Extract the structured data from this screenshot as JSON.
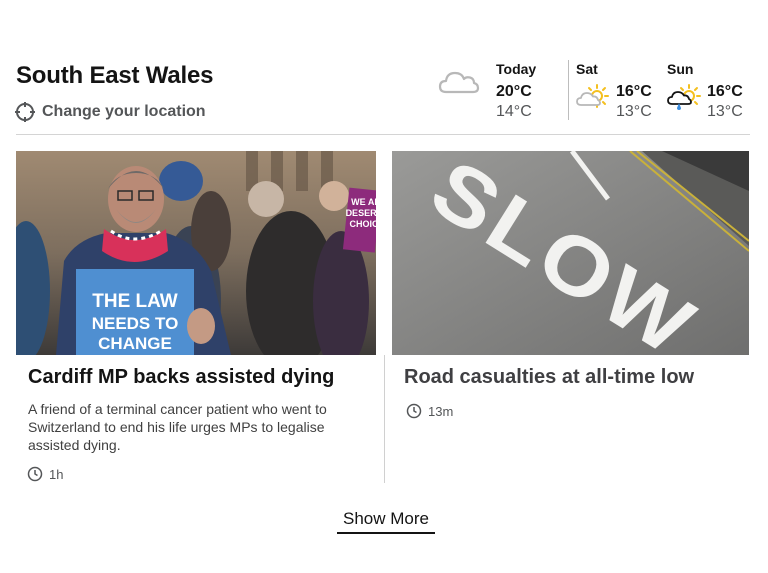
{
  "location": {
    "title": "South East Wales",
    "change_label": "Change your location"
  },
  "weather": {
    "today": {
      "day": "Today",
      "high": "20°C",
      "low": "14°C",
      "icon": "cloud-icon"
    },
    "sat": {
      "day": "Sat",
      "high": "16°C",
      "low": "13°C",
      "icon": "sun-cloud-icon"
    },
    "sun": {
      "day": "Sun",
      "high": "16°C",
      "low": "13°C",
      "icon": "sun-cloud-rain-icon"
    }
  },
  "stories": [
    {
      "headline": "Cardiff MP backs assisted dying",
      "summary": "A friend of a terminal cancer patient who went to Switzerland to end his life urges MPs to legalise assisted dying.",
      "time": "1h",
      "image_sign": [
        "THE LAW",
        "NEEDS TO",
        "CHANGE"
      ],
      "image_placard": [
        "WE AI",
        "DESERV",
        "CHOIC"
      ]
    },
    {
      "headline": "Road casualties at all-time low",
      "time": "13m",
      "image_road_text": "SLOW"
    }
  ],
  "show_more_label": "Show More",
  "colors": {
    "text": "#141414",
    "secondary": "#545658",
    "sign_blue": "#4f8fd1",
    "placard_purple": "#8d2b7c"
  }
}
